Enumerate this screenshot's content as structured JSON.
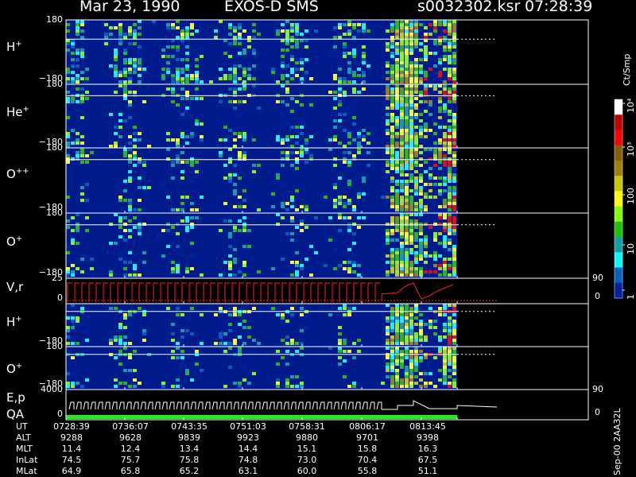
{
  "header": {
    "date": "Mar 23, 1990",
    "instrument": "EXOS-D SMS",
    "file": "s0032302.ksr",
    "time": "07:28:39"
  },
  "panels": [
    {
      "label": "H",
      "sup": "+",
      "ytop": "180",
      "ybot": "−180"
    },
    {
      "label": "He",
      "sup": "+",
      "ytop": "180",
      "ybot": "−180"
    },
    {
      "label": "O",
      "sup": "++",
      "ytop": "180",
      "ybot": "−180"
    },
    {
      "label": "O",
      "sup": "+",
      "ytop": "180",
      "ybot": "−180"
    },
    {
      "label": "V,r",
      "sup": "",
      "ytop": "25",
      "ybot": "0",
      "rtop": "90",
      "rbot": "0"
    },
    {
      "label": "H",
      "sup": "+",
      "ytop": "",
      "ybot": "−180"
    },
    {
      "label": "O",
      "sup": "+",
      "ytop": "180",
      "ybot": "−180"
    },
    {
      "label": "E,p",
      "sup": "",
      "ytop": "4000",
      "ybot": "0",
      "rtop": "90",
      "rbot": "0",
      "label2": "QA"
    }
  ],
  "colorbar": {
    "title": "Ct/Smp",
    "ticks": [
      "10⁴",
      "10³",
      "100",
      "10",
      "1"
    ],
    "colors": [
      "#ffffff",
      "#c00000",
      "#ff0000",
      "#806000",
      "#a08000",
      "#c8c800",
      "#ffff00",
      "#80ff00",
      "#20c000",
      "#10a0a0",
      "#00ffff",
      "#0060c0",
      "#0020a0"
    ]
  },
  "footer": {
    "side_text": "Sep-00 2AA32L",
    "rows": [
      {
        "name": "UT",
        "values": [
          "0728:39",
          "0736:07",
          "0743:35",
          "0751:03",
          "0758:31",
          "0806:17",
          "0813:45"
        ]
      },
      {
        "name": "ALT",
        "values": [
          "9288",
          "9628",
          "9839",
          "9923",
          "9880",
          "9701",
          "9398"
        ]
      },
      {
        "name": "MLT",
        "values": [
          "11.4",
          "12.4",
          "13.4",
          "14.4",
          "15.1",
          "15.8",
          "16.3"
        ]
      },
      {
        "name": "InLat",
        "values": [
          "74.5",
          "75.7",
          "75.8",
          "74.8",
          "73.0",
          "70.4",
          "67.5"
        ]
      },
      {
        "name": "MLat",
        "values": [
          "64.9",
          "65.8",
          "65.2",
          "63.1",
          "60.0",
          "55.8",
          "51.1"
        ]
      }
    ]
  },
  "chart_data": {
    "type": "heatmap",
    "x": [
      "0728:39",
      "0736:07",
      "0743:35",
      "0751:03",
      "0758:31",
      "0806:17",
      "0813:45"
    ],
    "panels": [
      "H+",
      "He+",
      "O++",
      "O+",
      "V,r",
      "H+",
      "O+",
      "E,p / QA"
    ],
    "ylim": [
      -180,
      180
    ],
    "colorbar_unit": "Ct/Smp",
    "colorbar_range": [
      1,
      10000
    ]
  }
}
